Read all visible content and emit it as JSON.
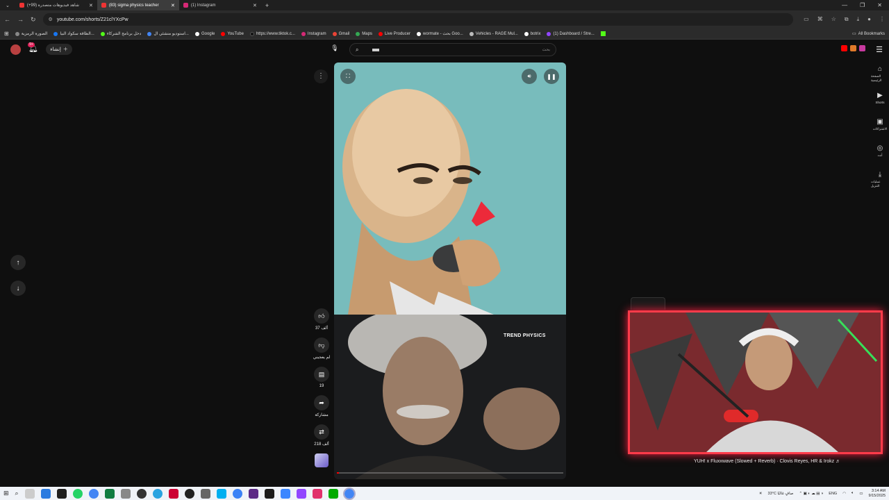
{
  "tabs": [
    {
      "title": "شاهد فيديوهات متصدرة (99+)",
      "color": "#e33",
      "active": false
    },
    {
      "title": "(83) sigma physics teacher",
      "color": "#e33",
      "active": true
    },
    {
      "title": "(1) Instagram",
      "color": "#d62976",
      "active": false
    }
  ],
  "address": {
    "url": "youtube.com/shorts/Z21clYXcPw"
  },
  "bookmarks": [
    {
      "label": "الصورة الرمزية",
      "color": "#888"
    },
    {
      "label": "الطاقة سكواد البيا...",
      "color": "#1877f2"
    },
    {
      "label": "دخل برنامج الشركاء",
      "color": "#53fc18"
    },
    {
      "label": "استوديو منشئي ال...",
      "color": "#4285f4"
    },
    {
      "label": "Google",
      "color": "#fff"
    },
    {
      "label": "YouTube",
      "color": "#f00"
    },
    {
      "label": "https://www.tiktok.c...",
      "color": "#000"
    },
    {
      "label": "Instagram",
      "color": "#d62976"
    },
    {
      "label": "Gmail",
      "color": "#ea4335"
    },
    {
      "label": "Maps",
      "color": "#34a853"
    },
    {
      "label": "Live Producer",
      "color": "#f00"
    },
    {
      "label": "wormate - بحث Goo...",
      "color": "#fff"
    },
    {
      "label": "Vehicles - RAGE Mul...",
      "color": "#bbb"
    },
    {
      "label": "botrix",
      "color": "#fff"
    },
    {
      "label": "(1) Dashboard / Stre...",
      "color": "#9146ff"
    }
  ],
  "bookmarks_all": "All Bookmarks",
  "header": {
    "create_label": "إنشاء",
    "search_placeholder": "بحث",
    "notif_count": "9+"
  },
  "right_nav": [
    {
      "icon": "home-icon",
      "glyph": "⌂",
      "label": "الصفحة الرئيسية"
    },
    {
      "icon": "shorts-icon",
      "glyph": "▶",
      "label": "Shorts"
    },
    {
      "icon": "subscriptions-icon",
      "glyph": "▣",
      "label": "الاشتراكات"
    },
    {
      "icon": "you-icon",
      "glyph": "◎",
      "label": "أنت"
    },
    {
      "icon": "downloads-icon",
      "glyph": "⤓",
      "label": "عمليات التنزيل"
    }
  ],
  "video": {
    "overlay_text": "TREND PHYSICS",
    "progress": 0.01
  },
  "actions": {
    "like_count": "37 ألف",
    "dislike_label": "لم يعجبني",
    "comments_count": "19",
    "share_label": "مشاركة",
    "remix_count": "218 ألف"
  },
  "webcam": {
    "song": "YUH! x Fluxxwave (Slowed + Reverb) · Clovis Reyes, HR & Irokz ♬"
  },
  "taskbar": {
    "weather": "33°C صافٍ غالبًا",
    "lang": "ENG",
    "time": "3:14 AM",
    "date": "9/15/2025"
  },
  "colors": {
    "accent": "#ff0000",
    "webcam_border": "#ff3b4a"
  }
}
